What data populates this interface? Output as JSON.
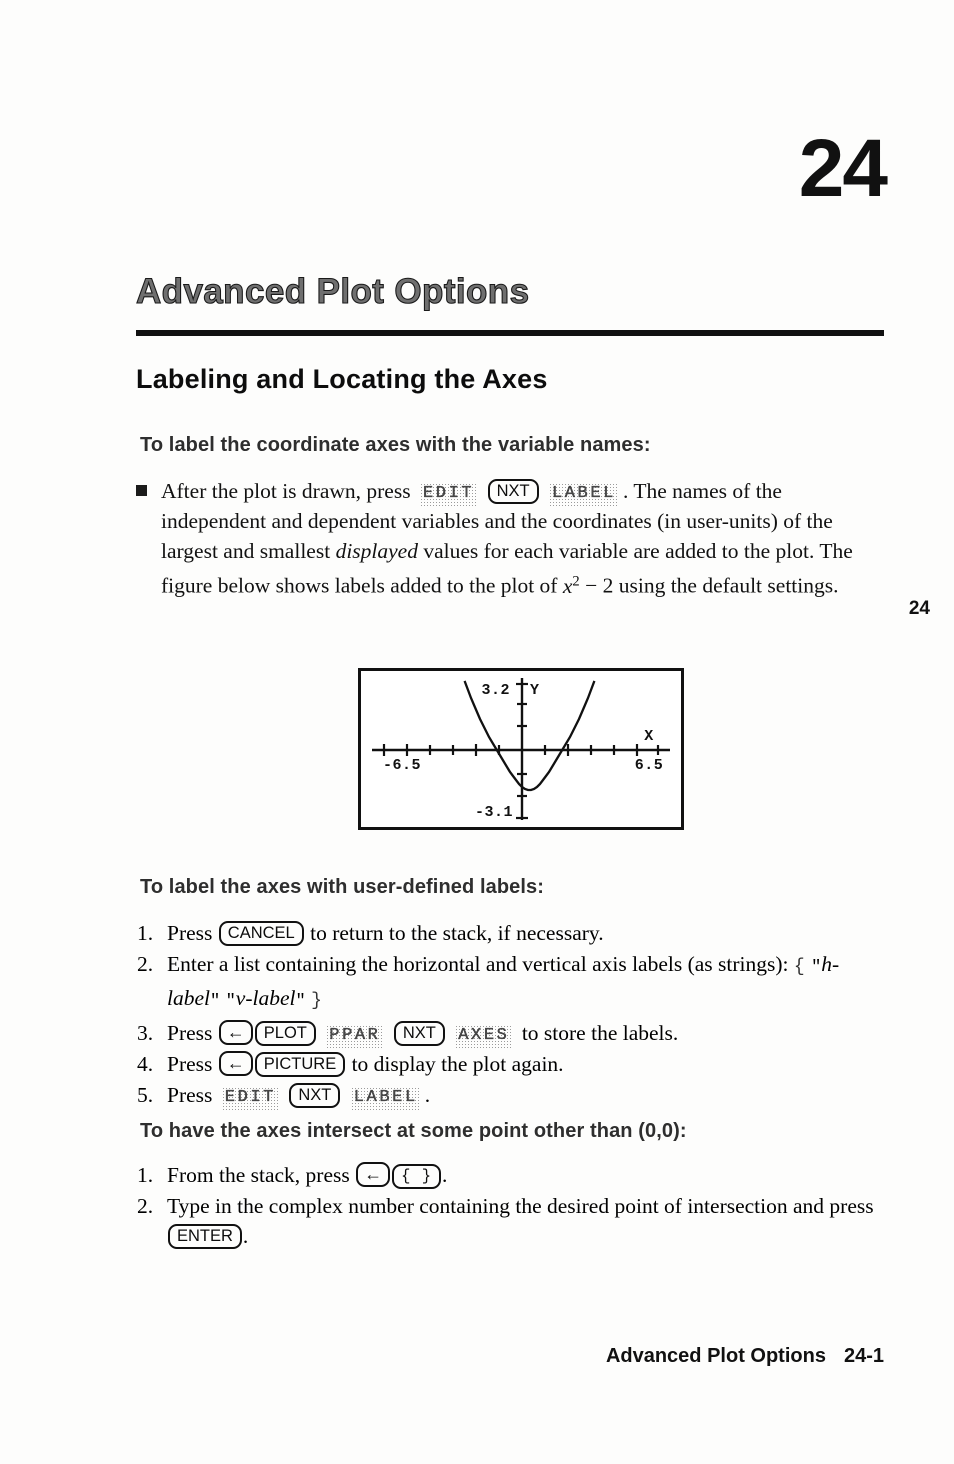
{
  "page": {
    "chapter_number": "24",
    "chapter_title": "Advanced Plot Options",
    "margin_tab": "24",
    "footer_title": "Advanced Plot Options",
    "footer_page": "24-1"
  },
  "section": {
    "heading": "Labeling and Locating the Axes"
  },
  "sub1": {
    "heading": "To label the coordinate axes with the variable names:",
    "bullet": {
      "lead": "After the plot is drawn, press",
      "key_edit": "EDIT",
      "key_nxt": "NXT",
      "key_label": "LABEL",
      "rest_1": ". The names of the independent and dependent variables and the coordinates (in user-units) of the largest and smallest",
      "emphasis": "displayed",
      "rest_2": "values for each variable are added to the plot. The figure below shows labels added to the plot of",
      "math_base": "x",
      "math_exp": "2",
      "math_tail": "− 2",
      "rest_3": "using the default settings."
    }
  },
  "sub2": {
    "heading": "To label the axes with user-defined labels:",
    "steps": [
      {
        "num": "1.",
        "pre": "Press",
        "keys": [
          {
            "type": "hard",
            "label": "CANCEL"
          }
        ],
        "post": "to return to the stack, if necessary."
      },
      {
        "num": "2.",
        "pre": "Enter a list containing the horizontal and vertical axis labels (as strings):",
        "keys": [],
        "post": "",
        "literal": {
          "open": "{",
          "q1_open": "\"",
          "label_h": "h-label",
          "q1_close": "\"",
          "q2_open": "\"",
          "label_v": "v-label",
          "q2_close": "\"",
          "close": "}"
        }
      },
      {
        "num": "3.",
        "pre": "Press",
        "keys": [
          {
            "type": "hard",
            "label": "←"
          },
          {
            "type": "hard",
            "label": "PLOT"
          },
          {
            "type": "soft",
            "label": "PPAR"
          },
          {
            "type": "hard",
            "label": "NXT"
          },
          {
            "type": "soft",
            "label": "AXES"
          }
        ],
        "post": "to store the labels."
      },
      {
        "num": "4.",
        "pre": "Press",
        "keys": [
          {
            "type": "hard",
            "label": "←"
          },
          {
            "type": "hard",
            "label": "PICTURE"
          }
        ],
        "post": "to display the plot again."
      },
      {
        "num": "5.",
        "pre": "Press",
        "keys": [
          {
            "type": "soft",
            "label": "EDIT"
          },
          {
            "type": "hard",
            "label": "NXT"
          },
          {
            "type": "soft",
            "label": "LABEL"
          }
        ],
        "post": "."
      }
    ]
  },
  "sub3": {
    "heading": "To have the axes intersect at some point other than (0,0):",
    "steps": [
      {
        "num": "1.",
        "pre": "From the stack, press",
        "keys": [
          {
            "type": "hard",
            "label": "←"
          },
          {
            "type": "brace",
            "label": "{ }"
          }
        ],
        "post": "."
      },
      {
        "num": "2.",
        "pre": "Type in the complex number containing the desired point of intersection and press",
        "keys": [
          {
            "type": "hard",
            "label": "ENTER"
          }
        ],
        "post": "."
      }
    ]
  },
  "figure": {
    "caption": "",
    "labels": {
      "y_max": "3.2",
      "y_axis_name": "Y",
      "x_axis_name": "X",
      "x_min": "-6.5",
      "x_max": "6.5",
      "y_min": "-3.1"
    }
  },
  "chart_data": {
    "type": "line",
    "title": "",
    "xlabel": "X",
    "ylabel": "Y",
    "function": "x^2 - 2",
    "xlim": [
      -6.5,
      6.5
    ],
    "ylim": [
      -3.1,
      3.2
    ],
    "grid": false,
    "x_tick_labels": [
      "-6.5",
      "6.5"
    ],
    "y_tick_labels": [
      "3.2",
      "-3.1"
    ],
    "x_tick_count": 13,
    "legend": "none",
    "series": [
      {
        "name": "x^2 - 2",
        "x": [
          -2.3,
          -2.1,
          -1.9,
          -1.7,
          -1.5,
          -1.3,
          -1.1,
          -0.9,
          -0.7,
          -0.5,
          -0.3,
          -0.1,
          0.1,
          0.3,
          0.5,
          0.7,
          0.9,
          1.1,
          1.3,
          1.5,
          1.7,
          1.9,
          2.1,
          2.3
        ],
        "y": [
          3.29,
          2.41,
          1.61,
          0.89,
          0.25,
          -0.31,
          -0.79,
          -1.19,
          -1.51,
          -1.75,
          -1.91,
          -1.99,
          -1.99,
          -1.91,
          -1.75,
          -1.51,
          -1.19,
          -0.79,
          -0.31,
          0.25,
          0.89,
          1.61,
          2.41,
          3.29
        ]
      }
    ]
  }
}
